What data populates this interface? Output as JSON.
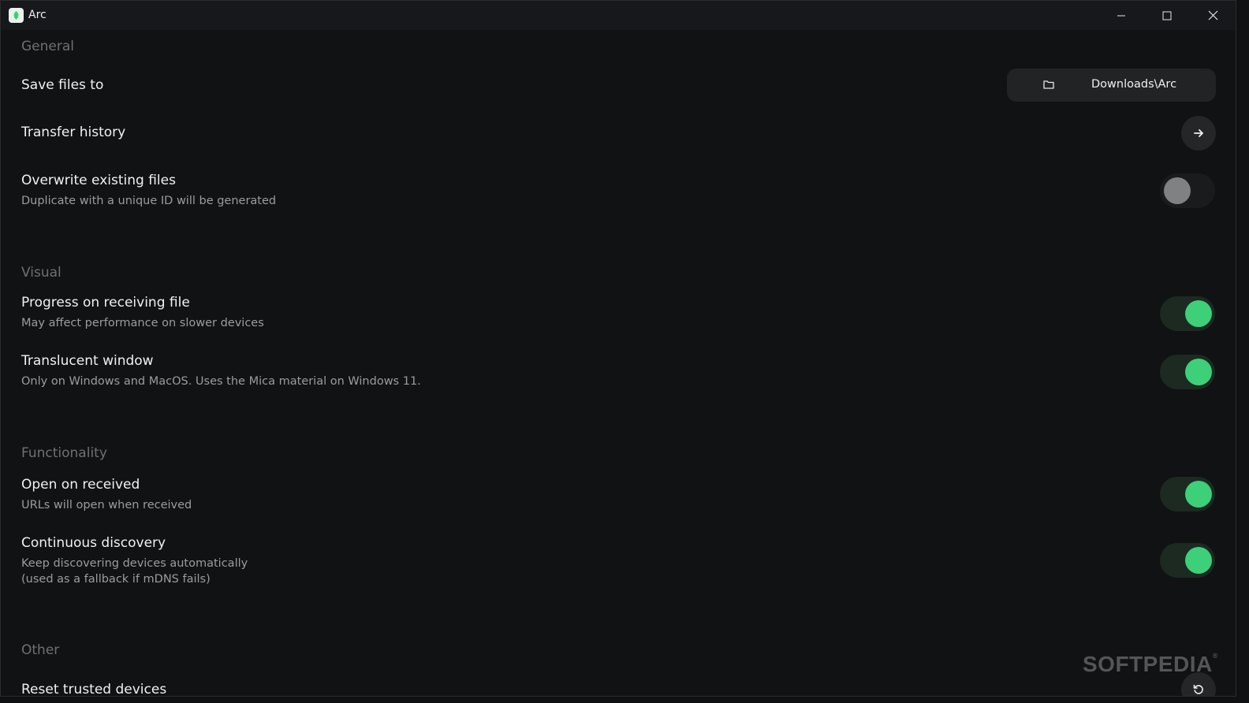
{
  "window": {
    "title": "Arc",
    "controls": [
      "minimize",
      "maximize",
      "close"
    ]
  },
  "sections": {
    "general": {
      "title": "General",
      "save_files": {
        "label": "Save files to",
        "path": "Downloads\\Arc",
        "icon": "folder-icon"
      },
      "transfer_history": {
        "label": "Transfer history",
        "icon": "arrow-right-icon"
      },
      "overwrite": {
        "label": "Overwrite existing files",
        "description": "Duplicate with a unique ID will be generated",
        "enabled": false
      }
    },
    "visual": {
      "title": "Visual",
      "progress": {
        "label": "Progress on receiving file",
        "description": "May affect performance on slower devices",
        "enabled": true
      },
      "translucent": {
        "label": "Translucent window",
        "description": "Only on Windows and MacOS. Uses the Mica material on Windows 11.",
        "enabled": true
      }
    },
    "functionality": {
      "title": "Functionality",
      "open_on_received": {
        "label": "Open on received",
        "description": "URLs will open when received",
        "enabled": true
      },
      "continuous_discovery": {
        "label": "Continuous discovery",
        "description_line1": "Keep discovering devices automatically",
        "description_line2": "(used as a fallback if mDNS fails)",
        "enabled": true
      }
    },
    "other": {
      "title": "Other",
      "reset_trusted": {
        "label": "Reset trusted devices",
        "icon": "reset-icon"
      }
    }
  },
  "watermark": {
    "text": "SOFTPEDIA",
    "mark": "®"
  },
  "colors": {
    "accent": "#3ecf79",
    "background": "#111213",
    "titlebar": "#16181c"
  }
}
